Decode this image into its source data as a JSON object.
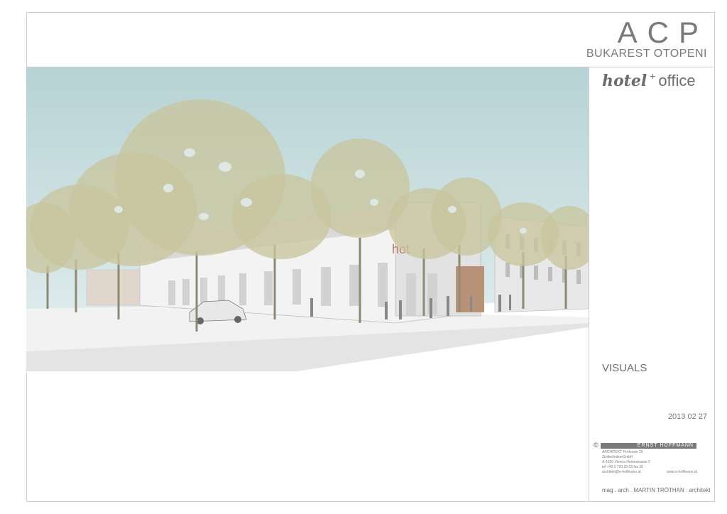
{
  "header": {
    "logo": "ACP",
    "subtitle": "BUKAREST OTOPENI"
  },
  "project": {
    "hotel_word": "hotel",
    "plus": "+",
    "office_word": "office"
  },
  "section_label": "VISUALS",
  "date": "2013 02 27",
  "credits": {
    "copyright_symbol": "©",
    "firm_name": "ERNST HOFFMANN",
    "lines": [
      {
        "left": "ARCHITEKT    Professor DI"
      },
      {
        "left": "ZiviltechnikerGmbH"
      },
      {
        "left": "A-1020 Vienna    Heinestrasse 2"
      },
      {
        "left": "tel +43 1 720 20 03    fax 20"
      },
      {
        "left": "architekt@e-hoffmann.at",
        "right": "www.e-hoffmann.at"
      }
    ]
  },
  "architect_line": "mag . arch . MARTIN TRÖTHAN . architekt",
  "render": {
    "facade_sign": "hot",
    "colors": {
      "sky": "#bcd6d8",
      "foliage": "#c8c59e",
      "building": "#e9e9e9",
      "wood": "#b89276"
    }
  }
}
